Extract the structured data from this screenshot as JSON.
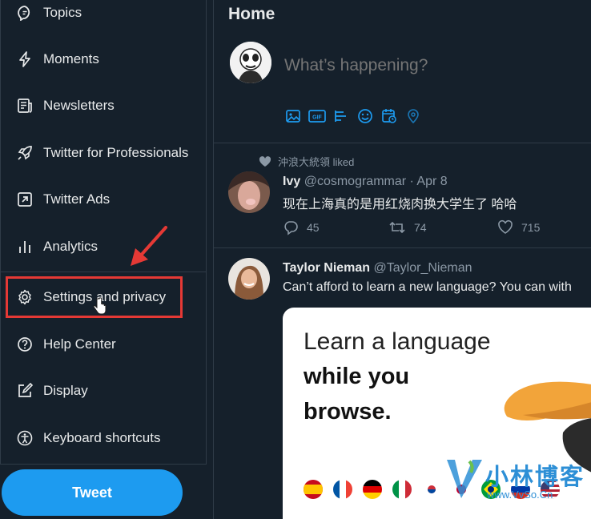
{
  "menu": {
    "items": [
      {
        "label": "Topics",
        "icon": "topics-icon"
      },
      {
        "label": "Moments",
        "icon": "lightning-icon"
      },
      {
        "label": "Newsletters",
        "icon": "newsletter-icon"
      },
      {
        "label": "Twitter for Professionals",
        "icon": "rocket-icon"
      },
      {
        "label": "Twitter Ads",
        "icon": "external-arrow-icon"
      },
      {
        "label": "Analytics",
        "icon": "bar-chart-icon"
      },
      {
        "label": "Settings and privacy",
        "icon": "gear-icon"
      },
      {
        "label": "Help Center",
        "icon": "help-icon"
      },
      {
        "label": "Display",
        "icon": "display-edit-icon"
      },
      {
        "label": "Keyboard shortcuts",
        "icon": "accessibility-icon"
      }
    ],
    "tweet_button": "Tweet"
  },
  "home": {
    "title": "Home",
    "compose_placeholder": "What’s happening?"
  },
  "tweets": [
    {
      "context": "沖浪大統領 liked",
      "name": "Ivy",
      "handle": "@cosmogrammar · Apr 8",
      "text": "现在上海真的是用红烧肉换大学生了 哈哈",
      "replies": "45",
      "retweets": "74",
      "likes": "715"
    },
    {
      "name": "Taylor Nieman",
      "handle": "@Taylor_Nieman",
      "text": "Can’t afford to learn a new language? You can with"
    }
  ],
  "ad_card": {
    "line1": "Learn a language",
    "line2": "while you",
    "line3": "browse."
  },
  "watermark": {
    "text": "小林博客",
    "url": "www.VvSo.Cn"
  },
  "colors": {
    "background": "#15202b",
    "accent": "#1d9bf0",
    "highlight": "#e53935"
  }
}
